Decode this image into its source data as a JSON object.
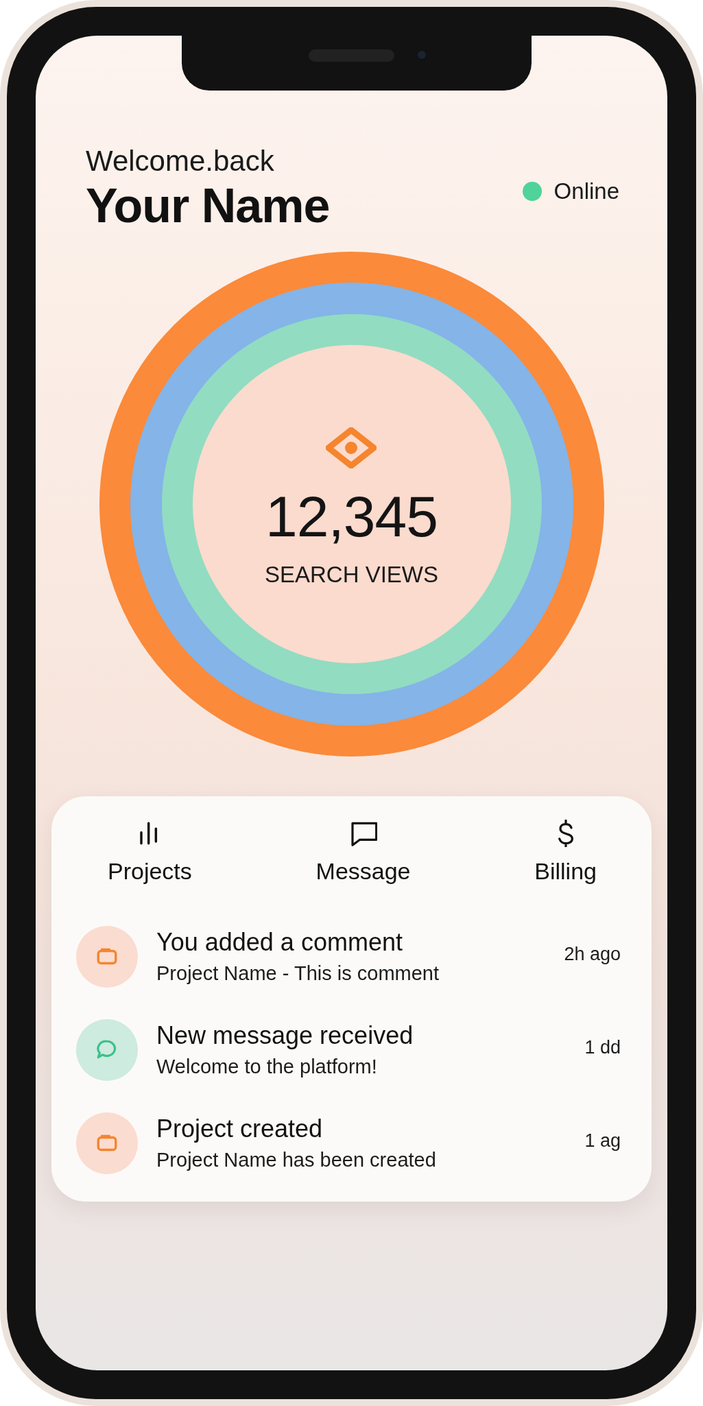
{
  "header": {
    "greeting": "Welcome.back",
    "name": "Your Name"
  },
  "status": {
    "label": "Online",
    "online": true
  },
  "stats": {
    "value": "12,345",
    "label": "SEARCH VIEWS"
  },
  "nav": [
    {
      "kind": "projects",
      "label": "Projects"
    },
    {
      "kind": "message",
      "label": "Message"
    },
    {
      "kind": "billing",
      "label": "Billing"
    }
  ],
  "activities": [
    {
      "kind": "project",
      "title": "You added a comment",
      "subtitle": "Project Name - This is comment",
      "time": "2h ago"
    },
    {
      "kind": "message",
      "title": "New message received",
      "subtitle": "Welcome to the platform!",
      "time": "1 dd"
    },
    {
      "kind": "project",
      "title": "Project created",
      "subtitle": "Project Name has been created",
      "time": "1 ag"
    }
  ]
}
